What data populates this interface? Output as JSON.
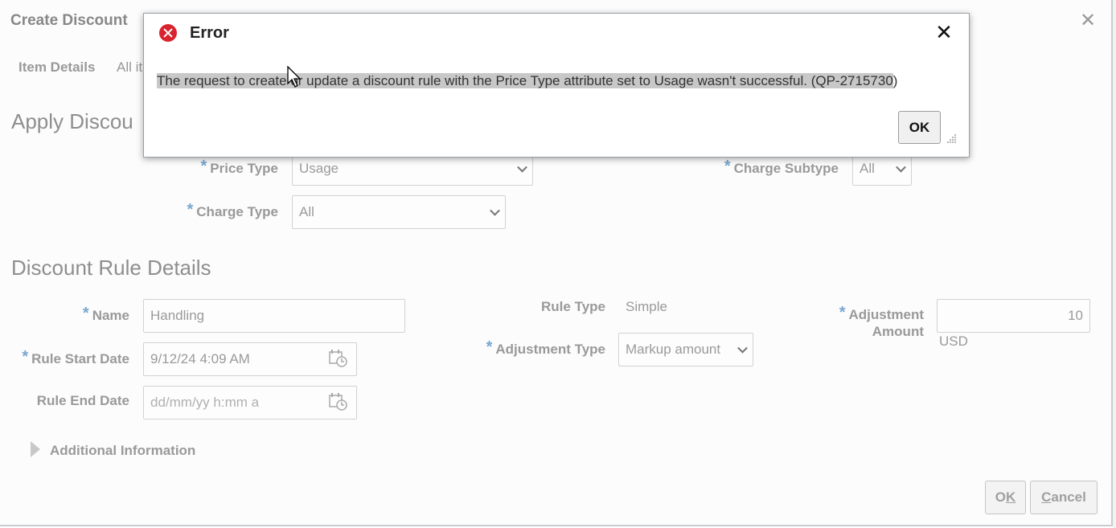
{
  "dialog": {
    "title": "Create Discount",
    "item_details_label": "Item Details",
    "item_details_value": "All it",
    "apply_section_title": "Apply Discou",
    "price_type": {
      "label": "Price Type",
      "value": "Usage"
    },
    "charge_subtype": {
      "label": "Charge Subtype",
      "value": "All"
    },
    "charge_type": {
      "label": "Charge Type",
      "value": "All"
    },
    "rule_section_title": "Discount Rule Details",
    "name": {
      "label": "Name",
      "value": "Handling"
    },
    "rule_start_date": {
      "label": "Rule Start Date",
      "value": "9/12/24 4:09 AM"
    },
    "rule_end_date": {
      "label": "Rule End Date",
      "placeholder": "dd/mm/yy h:mm a"
    },
    "rule_type": {
      "label": "Rule Type",
      "value": "Simple"
    },
    "adjustment_type": {
      "label": "Adjustment Type",
      "value": "Markup amount"
    },
    "adjustment_amount": {
      "label_line1": "Adjustment",
      "label_line2": "Amount",
      "value": "10",
      "currency": "USD"
    },
    "additional_info_label": "Additional Information",
    "ok_button": {
      "first": "O",
      "rest": "K"
    },
    "cancel_button": {
      "first": "C",
      "rest": "ancel"
    }
  },
  "error_popup": {
    "title": "Error",
    "message_selected": "The request to create or update a discount rule with the Price Type attribute set to Usage wasn't successful. (QP-2715730",
    "message_rest": ")",
    "ok_label": "OK"
  },
  "colors": {
    "required_asterisk": "#79a6cf",
    "error_icon": "#d9232e"
  }
}
